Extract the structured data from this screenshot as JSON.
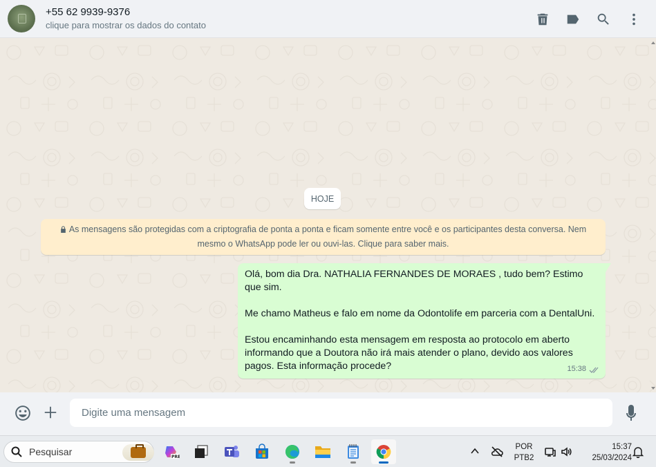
{
  "header": {
    "contact_name": "+55 62 9939-9376",
    "contact_subtitle": "clique para mostrar os dados do contato",
    "icons": [
      "delete-icon",
      "label-icon",
      "search-icon",
      "menu-icon"
    ]
  },
  "chat": {
    "date_divider": "HOJE",
    "encryption_notice": "As mensagens são protegidas com a criptografia de ponta a ponta e ficam somente entre você e os participantes desta conversa. Nem mesmo o WhatsApp pode ler ou ouvi-las. Clique para saber mais.",
    "messages": [
      {
        "direction": "outgoing",
        "paragraphs": [
          "Olá, bom dia Dra. NATHALIA FERNANDES DE MORAES , tudo bem? Estimo que sim.",
          "Me chamo Matheus e falo em nome da Odontolife em parceria com a DentalUni.",
          "Estou encaminhando esta mensagem em resposta ao protocolo em aberto informando que a Doutora não irá mais atender o plano, devido aos valores pagos. Esta informação procede?"
        ],
        "time": "15:38",
        "status": "delivered"
      }
    ],
    "bubble_color": "#d9fdd3",
    "notice_color": "#ffeecd"
  },
  "composer": {
    "placeholder": "Digite uma mensagem"
  },
  "taskbar": {
    "search_label": "Pesquisar",
    "apps": [
      "copilot-icon",
      "task-view-icon",
      "teams-icon",
      "store-icon",
      "edge-icon",
      "file-explorer-icon",
      "notepad-icon",
      "chrome-icon"
    ],
    "language_line1": "POR",
    "language_line2": "PTB2",
    "time": "15:37",
    "date": "25/03/2024"
  }
}
